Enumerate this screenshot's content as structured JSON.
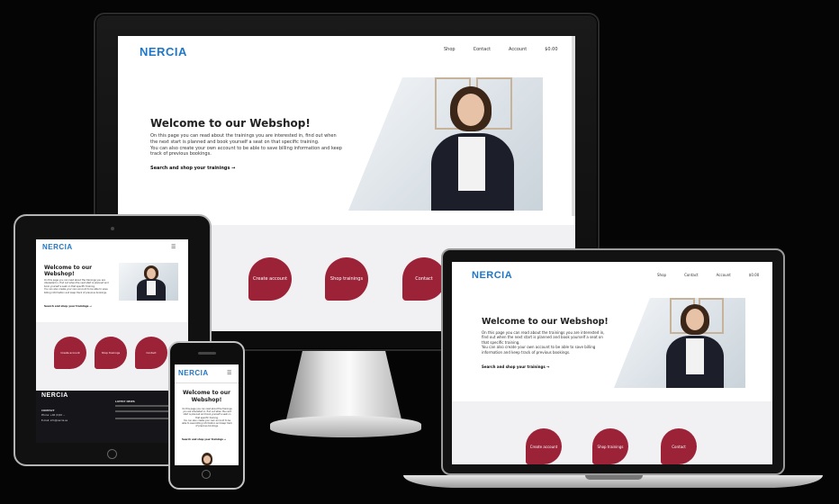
{
  "site": {
    "logo": "NERCIA",
    "nav": [
      "Shop",
      "Contact",
      "Account",
      "$0.00"
    ],
    "hero_title": "Welcome to our Webshop!",
    "hero_text_1": "On this page you can read about the trainings you are interested in, find out when the next start is planned and book yourself a seat on that specific training.",
    "hero_text_2": "You can also create your own account to be able to save billing information and keep track of previous bookings.",
    "hero_cta": "Search and shop your trainings →",
    "actions": [
      "Create account",
      "Shop trainings",
      "Contact"
    ],
    "phone_hero_title": "Welcome to our Webshop!"
  },
  "footer": {
    "logo": "NERCIA",
    "contact_heading": "CONTACT",
    "phone": "Phone: +46 (0)10 ...",
    "email": "E-mail: info@nercia.se",
    "latest_heading": "LATEST NEWS"
  },
  "colors": {
    "brand_blue": "#1f77c7",
    "accent_red": "#9c2238",
    "background": "#050505"
  }
}
